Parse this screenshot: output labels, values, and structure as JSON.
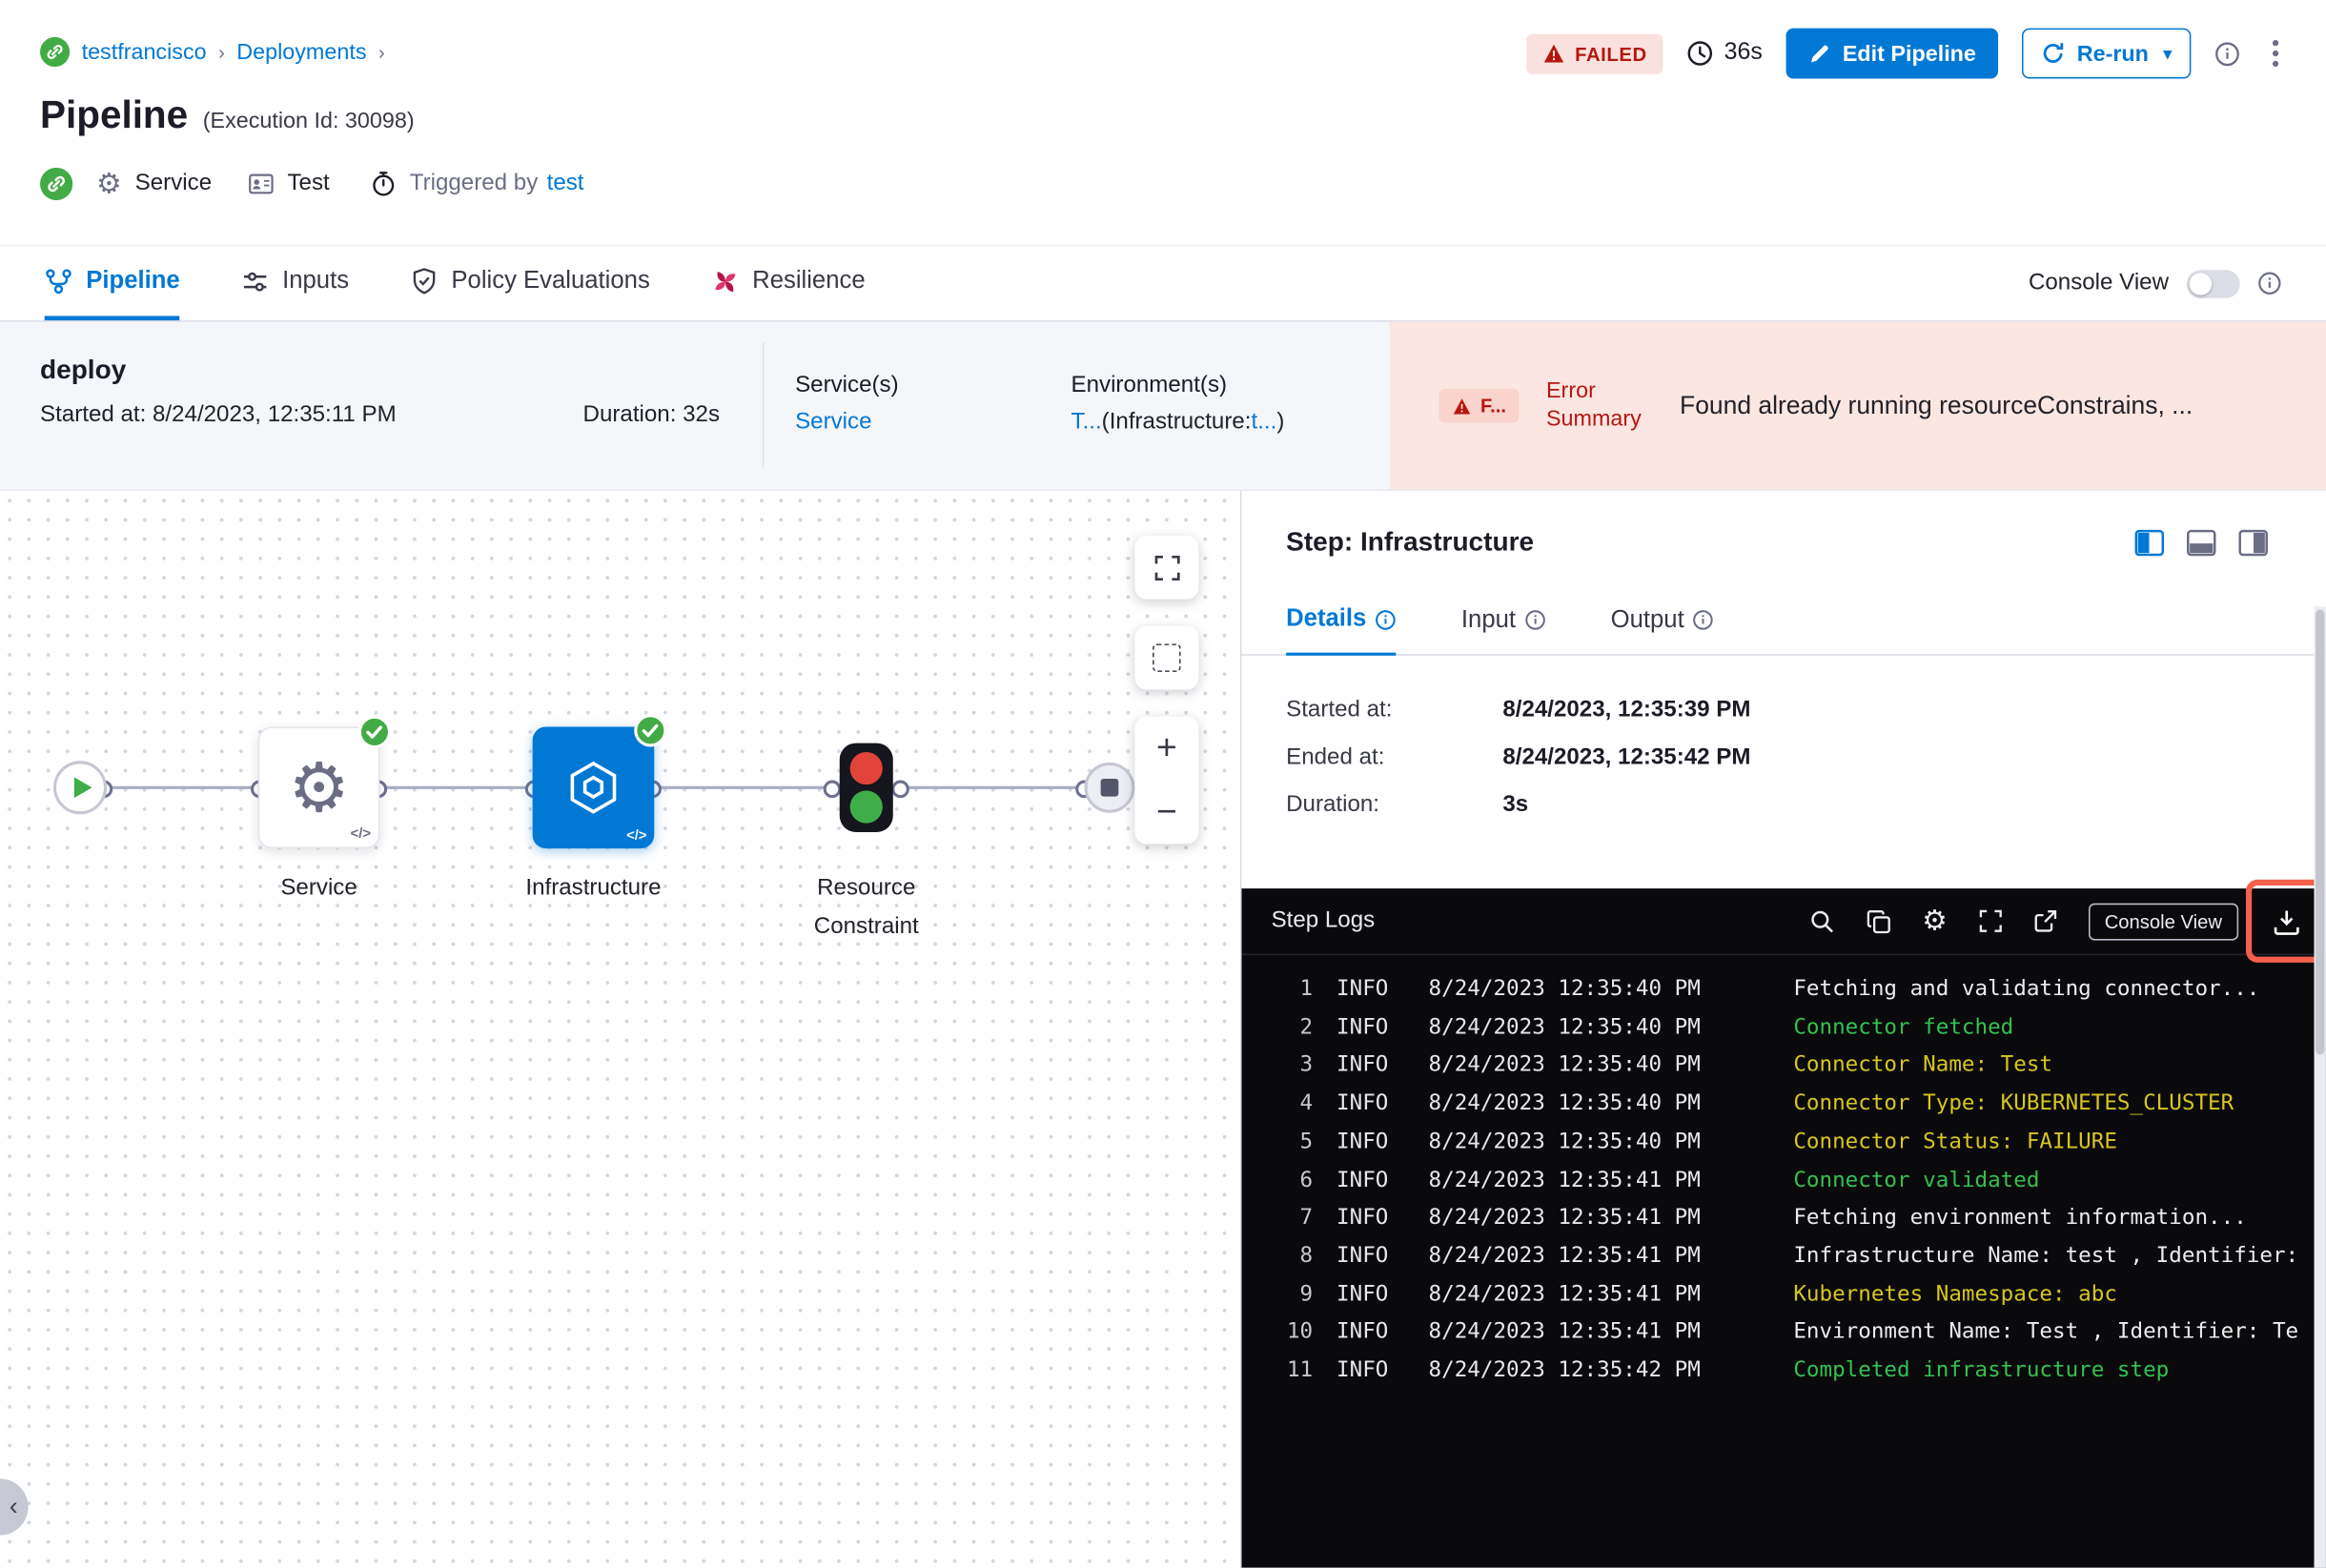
{
  "colors": {
    "accent_blue": "#0278d5",
    "error_red": "#b41710",
    "error_bg": "#fbe6e2",
    "success_green": "#42ab45",
    "log_green": "#35c04f",
    "log_yellow": "#d9c51f",
    "highlight_red": "#f4604c"
  },
  "breadcrumb": {
    "project": "testfrancisco",
    "section": "Deployments"
  },
  "header": {
    "title": "Pipeline",
    "execution_id": "(Execution Id: 30098)",
    "status_badge": "FAILED",
    "elapsed": "36s",
    "edit_pipeline": "Edit Pipeline",
    "rerun": "Re-run",
    "service": "Service",
    "test": "Test",
    "triggered_by": "Triggered by",
    "triggered_by_user": "test"
  },
  "tabs": {
    "pipeline": "Pipeline",
    "inputs": "Inputs",
    "policy": "Policy Evaluations",
    "resilience": "Resilience",
    "console_view": "Console View"
  },
  "stage": {
    "name": "deploy",
    "started_at": "Started at: 8/24/2023, 12:35:11 PM",
    "duration": "Duration: 32s",
    "services_label": "Service(s)",
    "services_value": "Service",
    "environments_label": "Environment(s)",
    "env_link1": "T...",
    "env_mid": "(Infrastructure:",
    "env_link2": "t...",
    "env_end": ")",
    "error_badge": "F...",
    "error_summary": "Error Summary",
    "error_message": "Found already running resourceConstrains, ..."
  },
  "graph": {
    "node_service": "Service",
    "node_infrastructure": "Infrastructure",
    "node_resource_constraint": "Resource Constraint",
    "code_tag": "</>"
  },
  "step_panel": {
    "title": "Step: Infrastructure",
    "tab_details": "Details",
    "tab_input": "Input",
    "tab_output": "Output",
    "details": [
      {
        "label": "Started at:",
        "value": "8/24/2023, 12:35:39 PM"
      },
      {
        "label": "Ended at:",
        "value": "8/24/2023, 12:35:42 PM"
      },
      {
        "label": "Duration:",
        "value": "3s"
      }
    ]
  },
  "logs": {
    "title": "Step Logs",
    "console_view": "Console View",
    "lines": [
      {
        "num": "1",
        "level": "INFO",
        "time": "8/24/2023 12:35:40 PM",
        "msg": "Fetching and validating connector...",
        "color": "white"
      },
      {
        "num": "2",
        "level": "INFO",
        "time": "8/24/2023 12:35:40 PM",
        "msg": "Connector fetched",
        "color": "green"
      },
      {
        "num": "3",
        "level": "INFO",
        "time": "8/24/2023 12:35:40 PM",
        "msg": "Connector Name: Test",
        "color": "yellow"
      },
      {
        "num": "4",
        "level": "INFO",
        "time": "8/24/2023 12:35:40 PM",
        "msg": "Connector Type: KUBERNETES_CLUSTER",
        "color": "yellow"
      },
      {
        "num": "5",
        "level": "INFO",
        "time": "8/24/2023 12:35:40 PM",
        "msg": "Connector Status: FAILURE",
        "color": "yellow"
      },
      {
        "num": "6",
        "level": "INFO",
        "time": "8/24/2023 12:35:41 PM",
        "msg": "Connector validated",
        "color": "green"
      },
      {
        "num": "7",
        "level": "INFO",
        "time": "8/24/2023 12:35:41 PM",
        "msg": "Fetching environment information...",
        "color": "white"
      },
      {
        "num": "8",
        "level": "INFO",
        "time": "8/24/2023 12:35:41 PM",
        "msg": "Infrastructure Name: test , Identifier:",
        "color": "white"
      },
      {
        "num": "9",
        "level": "INFO",
        "time": "8/24/2023 12:35:41 PM",
        "msg": "Kubernetes Namespace: abc",
        "color": "yellow"
      },
      {
        "num": "10",
        "level": "INFO",
        "time": "8/24/2023 12:35:41 PM",
        "msg": "Environment Name: Test , Identifier: Te",
        "color": "white"
      },
      {
        "num": "11",
        "level": "INFO",
        "time": "8/24/2023 12:35:42 PM",
        "msg": "Completed infrastructure step",
        "color": "green"
      }
    ]
  }
}
